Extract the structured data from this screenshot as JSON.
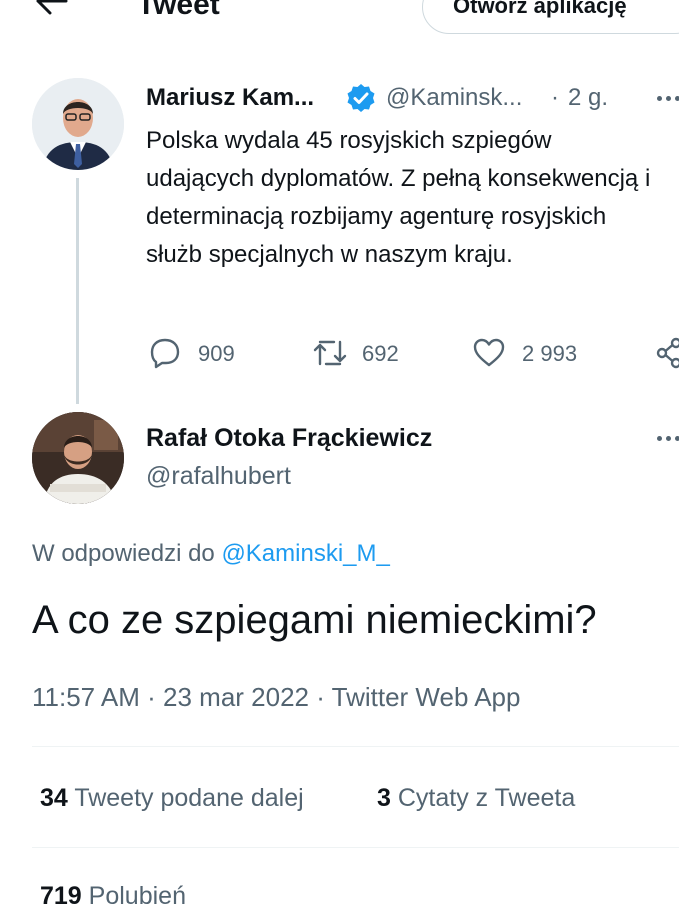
{
  "header": {
    "title": "Tweet",
    "open_app_label": "Otwórz aplikację",
    "back_icon": "arrow-left-icon"
  },
  "parent_tweet": {
    "author_name": "Mariusz Kam...",
    "verified_icon": "verified-badge-icon",
    "handle": "@Kaminsk...",
    "separator": "·",
    "time": "2 g.",
    "text": "Polska wydala 45 rosyjskich szpiegów udających dyplomatów. Z pełną konsekwencją i determinacją rozbijamy agenturę rosyjskich służb specjalnych w naszym kraju.",
    "actions": {
      "replies": "909",
      "retweets": "692",
      "likes": "2 993"
    }
  },
  "main_tweet": {
    "author_name": "Rafał Otoka Frąckiewicz",
    "handle": "@rafalhubert",
    "reply_to_prefix": "W odpowiedzi do",
    "reply_to_handle": "@Kaminski_M_",
    "text": "A co ze szpiegami niemieckimi?",
    "meta": "11:57 AM · 23 mar 2022 · Twitter Web App",
    "stats": {
      "retweets_count": "34",
      "retweets_label": "Tweety podane dalej",
      "quotes_count": "3",
      "quotes_label": "Cytaty z Tweeta",
      "likes_count": "719",
      "likes_label": "Polubień"
    }
  },
  "colors": {
    "accent": "#1d9bf0",
    "secondary_text": "#536471",
    "primary_text": "#0f1419"
  }
}
